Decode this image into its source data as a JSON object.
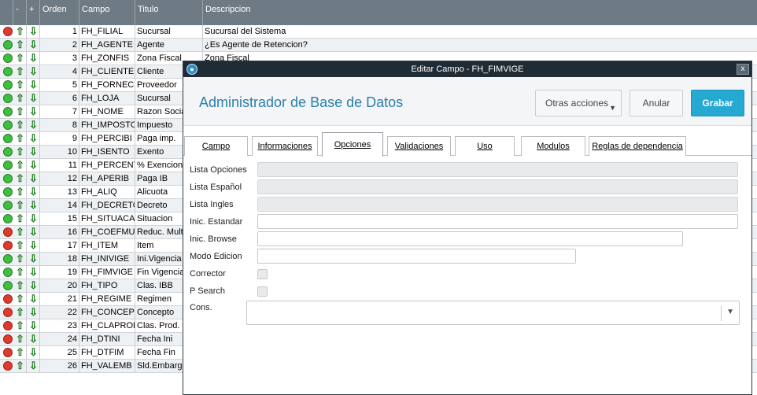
{
  "grid": {
    "headers": {
      "minus": "-",
      "plus": "+",
      "orden": "Orden",
      "campo": "Campo",
      "titulo": "Titulo",
      "descripcion": "Descripcion"
    },
    "rows": [
      {
        "status": "red",
        "orden": "1",
        "campo": "FH_FILIAL",
        "titulo": "Sucursal",
        "descripcion": "Sucursal del Sistema"
      },
      {
        "status": "green",
        "orden": "2",
        "campo": "FH_AGENTE",
        "titulo": "Agente",
        "descripcion": "¿Es Agente de Retencion?"
      },
      {
        "status": "green",
        "orden": "3",
        "campo": "FH_ZONFIS",
        "titulo": "Zona Fiscal",
        "descripcion": "Zona Fiscal"
      },
      {
        "status": "green",
        "orden": "4",
        "campo": "FH_CLIENTE",
        "titulo": "Cliente",
        "descripcion": ""
      },
      {
        "status": "green",
        "orden": "5",
        "campo": "FH_FORNECE",
        "titulo": "Proveedor",
        "descripcion": ""
      },
      {
        "status": "green",
        "orden": "6",
        "campo": "FH_LOJA",
        "titulo": "Sucursal",
        "descripcion": ""
      },
      {
        "status": "green",
        "orden": "7",
        "campo": "FH_NOME",
        "titulo": "Razon Social",
        "descripcion": ""
      },
      {
        "status": "green",
        "orden": "8",
        "campo": "FH_IMPOSTO",
        "titulo": "Impuesto",
        "descripcion": ""
      },
      {
        "status": "green",
        "orden": "9",
        "campo": "FH_PERCIBI",
        "titulo": "Paga imp.",
        "descripcion": ""
      },
      {
        "status": "green",
        "orden": "10",
        "campo": "FH_ISENTO",
        "titulo": "Exento",
        "descripcion": ""
      },
      {
        "status": "green",
        "orden": "11",
        "campo": "FH_PERCENT",
        "titulo": "% Exencion",
        "descripcion": ""
      },
      {
        "status": "green",
        "orden": "12",
        "campo": "FH_APERIB",
        "titulo": "Paga IB",
        "descripcion": ""
      },
      {
        "status": "green",
        "orden": "13",
        "campo": "FH_ALIQ",
        "titulo": "Alicuota",
        "descripcion": ""
      },
      {
        "status": "green",
        "orden": "14",
        "campo": "FH_DECRETO",
        "titulo": "Decreto",
        "descripcion": ""
      },
      {
        "status": "green",
        "orden": "15",
        "campo": "FH_SITUACA",
        "titulo": "Situacion",
        "descripcion": ""
      },
      {
        "status": "red",
        "orden": "16",
        "campo": "FH_COEFMUL",
        "titulo": "Reduc. Multa",
        "descripcion": ""
      },
      {
        "status": "red",
        "orden": "17",
        "campo": "FH_ITEM",
        "titulo": "Item",
        "descripcion": ""
      },
      {
        "status": "green",
        "orden": "18",
        "campo": "FH_INIVIGE",
        "titulo": "Ini.Vigencia",
        "descripcion": ""
      },
      {
        "status": "green",
        "orden": "19",
        "campo": "FH_FIMVIGE",
        "titulo": "Fin Vigencia",
        "descripcion": ""
      },
      {
        "status": "green",
        "orden": "20",
        "campo": "FH_TIPO",
        "titulo": "Clas. IBB",
        "descripcion": ""
      },
      {
        "status": "red",
        "orden": "21",
        "campo": "FH_REGIME",
        "titulo": "Regimen",
        "descripcion": ""
      },
      {
        "status": "red",
        "orden": "22",
        "campo": "FH_CONCEP",
        "titulo": "Concepto",
        "descripcion": ""
      },
      {
        "status": "red",
        "orden": "23",
        "campo": "FH_CLAPROD",
        "titulo": "Clas. Prod.",
        "descripcion": ""
      },
      {
        "status": "red",
        "orden": "24",
        "campo": "FH_DTINI",
        "titulo": "Fecha Ini",
        "descripcion": ""
      },
      {
        "status": "red",
        "orden": "25",
        "campo": "FH_DTFIM",
        "titulo": "Fecha Fin",
        "descripcion": ""
      },
      {
        "status": "red",
        "orden": "26",
        "campo": "FH_VALEMB",
        "titulo": "Sld.Embargo",
        "descripcion": ""
      }
    ],
    "up_arrow": "⇧",
    "down_arrow": "⇩"
  },
  "colors": {
    "status_red": "#e03a2e",
    "status_green": "#3fbf3f",
    "accent": "#25a8d1",
    "title_blue": "#2a7fab"
  },
  "modal": {
    "window_title": "Editar Campo - FH_FIMVIGE",
    "close_glyph": "x",
    "header_title": "Administrador de Base de Datos",
    "buttons": {
      "otras": "Otras acciones",
      "anular": "Anular",
      "grabar": "Grabar"
    },
    "tabs": [
      {
        "label": "Campo"
      },
      {
        "label": "Informaciones"
      },
      {
        "label": "Opciones"
      },
      {
        "label": "Validaciones"
      },
      {
        "label": "Uso"
      },
      {
        "label": "Modulos"
      },
      {
        "label": "Reglas de dependencia"
      }
    ],
    "active_tab": "Opciones",
    "fields": {
      "lista_opciones": {
        "label": "Lista Opciones",
        "value": ""
      },
      "lista_espanol": {
        "label": "Lista Español",
        "value": ""
      },
      "lista_ingles": {
        "label": "Lista Ingles",
        "value": ""
      },
      "inic_estandar": {
        "label": "Inic. Estandar",
        "value": ""
      },
      "inic_browse": {
        "label": "Inic. Browse",
        "value": ""
      },
      "modo_edicion": {
        "label": "Modo Edicion",
        "value": ""
      },
      "corrector": {
        "label": "Corrector",
        "checked": false
      },
      "p_search": {
        "label": "P Search",
        "checked": false
      },
      "cons": {
        "label": "Cons.",
        "value": ""
      }
    }
  }
}
